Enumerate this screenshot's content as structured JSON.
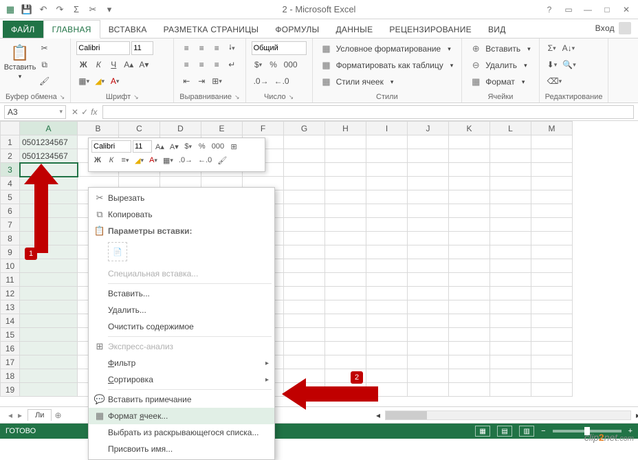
{
  "title": "2 - Microsoft Excel",
  "qat": {
    "undo": "↶",
    "redo": "↷",
    "sum": "Σ",
    "cut": "✂"
  },
  "tabs": {
    "file": "ФАЙЛ",
    "home": "ГЛАВНАЯ",
    "insert": "ВСТАВКА",
    "page_layout": "РАЗМЕТКА СТРАНИЦЫ",
    "formulas": "ФОРМУЛЫ",
    "data": "ДАННЫЕ",
    "review": "РЕЦЕНЗИРОВАНИЕ",
    "view": "ВИД",
    "login": "Вход"
  },
  "ribbon": {
    "clipboard": {
      "paste": "Вставить",
      "label": "Буфер обмена"
    },
    "font": {
      "name": "Calibri",
      "size": "11",
      "bold": "Ж",
      "italic": "К",
      "underline": "Ч",
      "label": "Шрифт"
    },
    "align": {
      "label": "Выравнивание"
    },
    "number": {
      "format": "Общий",
      "label": "Число"
    },
    "styles": {
      "cond": "Условное форматирование",
      "table": "Форматировать как таблицу",
      "cell": "Стили ячеек",
      "label": "Стили"
    },
    "cells": {
      "insert": "Вставить",
      "delete": "Удалить",
      "format": "Формат",
      "label": "Ячейки"
    },
    "editing": {
      "label": "Редактирование"
    }
  },
  "namebox": "A3",
  "columns": [
    "A",
    "B",
    "C",
    "D",
    "E",
    "F",
    "G",
    "H",
    "I",
    "J",
    "K",
    "L",
    "M"
  ],
  "rows": 19,
  "cells": {
    "A1": "0501234567",
    "A2": "0501234567"
  },
  "sheet_tab": "Ли",
  "mini": {
    "font": "Calibri",
    "size": "11",
    "bold": "Ж",
    "italic": "К"
  },
  "context": {
    "cut": "Вырезать",
    "copy": "Копировать",
    "paste_options": "Параметры вставки:",
    "paste_special": "Специальная вставка...",
    "insert": "Вставить...",
    "delete": "Удалить...",
    "clear": "Очистить содержимое",
    "quick_analysis": "Экспресс-анализ",
    "filter": "Фильтр",
    "sort": "Сортировка",
    "comment": "Вставить примечание",
    "format_cells": "Формат ячеек...",
    "dropdown": "Выбрать из раскрывающегося списка...",
    "name": "Присвоить имя..."
  },
  "status": {
    "ready": "ГОТОВО"
  },
  "annotations": {
    "b1": "1",
    "b2": "2"
  },
  "watermark": {
    "a": "clip",
    "b": "2",
    "c": "net",
    "d": ".com"
  }
}
